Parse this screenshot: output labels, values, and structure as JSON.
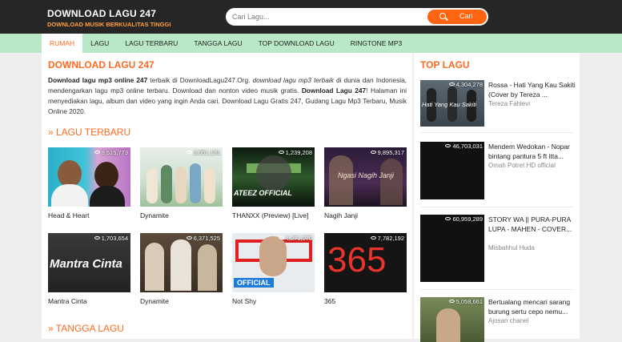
{
  "header": {
    "brand_title": "DOWNLOAD LAGU 247",
    "brand_tagline": "DOWNLOAD MUSIK BERKUALITAS TINGGI",
    "search_placeholder": "Cari Lagu...",
    "search_button": "Cari",
    "search_icon": "search-icon"
  },
  "nav": {
    "items": [
      "RUMAH",
      "LAGU",
      "LAGU TERBARU",
      "TANGGA LAGU",
      "TOP DOWNLOAD LAGU",
      "RINGTONE MP3"
    ]
  },
  "main": {
    "title": "DOWNLOAD LAGU 247",
    "intro": {
      "b1": "Download lagu mp3 online 247",
      "t1": " terbaik di DownloadLagu247.Org. ",
      "i1": "download lagu mp3 terbaik",
      "t2": " di dunia dan Indonesia, mendengarkan lagu mp3 online terbaru. Download dan nonton video musik gratis. ",
      "b2": "Download Lagu 247",
      "t3": "! Halaman ini menyediakan lagu, album dan video yang ingin Anda cari. Download Lagu Gratis 247, Gudang Lagu Mp3 Terbaru, Musik Online 2020."
    },
    "sec_terbaru": "» LAGU TERBARU",
    "sec_tangga": "» TANGGA LAGU",
    "cards": [
      {
        "title": "Head & Heart",
        "views": "8,515,773"
      },
      {
        "title": "Dynamite",
        "views": "3,051,131"
      },
      {
        "title": "THANXX (Preview) [Live]",
        "views": "1,239,208"
      },
      {
        "title": "Nagih Janji",
        "views": "9,895,317"
      },
      {
        "title": "Mantra Cinta",
        "views": "1,703,654"
      },
      {
        "title": "Dynamite",
        "views": "6,371,525"
      },
      {
        "title": "Not Shy",
        "views": "4,271,070"
      },
      {
        "title": "365",
        "views": "7,782,192"
      }
    ],
    "thumb_texts": {
      "nagih": "Ngasi Nagih Janji",
      "ateez": "ATEEZ OFFICIAL",
      "mantra": "Mantra Cinta",
      "official": "OFFICIAL",
      "num365": "365"
    }
  },
  "sidebar": {
    "title": "TOP LAGU",
    "items": [
      {
        "title": "Rossa - Hati Yang Kau Sakiti (Cover by Tereza ...",
        "channel": "Tereza Fahlevi",
        "views": "4,304,278",
        "thumb_text": "Hati Yang Kau Sakiti"
      },
      {
        "title": "Mendem Wedokan - Nopar bintang pantura 5 ft itta...",
        "channel": "Omah Potret HD official",
        "views": "46,703,031"
      },
      {
        "title": "STORY WA || PURA-PURA LUPA - MAHEN - COVER...",
        "channel": "Misbahhul Huda",
        "views": "60,959,289"
      },
      {
        "title": "Bertualang mencari sarang burung sertu cepo nemu...",
        "channel": "Ajosan chanel",
        "views": "5,058,661"
      }
    ]
  },
  "icons": {
    "views": "eye-icon"
  }
}
